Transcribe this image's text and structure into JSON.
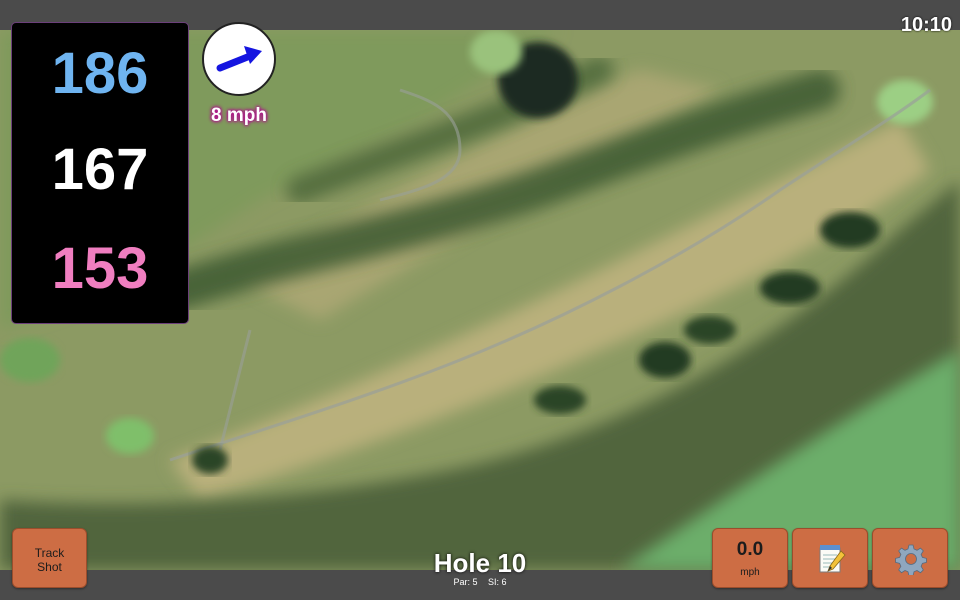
{
  "status": {
    "time": "10:10"
  },
  "distances": {
    "back": "186",
    "middle": "167",
    "front": "153"
  },
  "wind": {
    "speed_label": "8 mph"
  },
  "buttons": {
    "track_shot_line1": "Track",
    "track_shot_line2": "Shot",
    "speed_value": "0.0",
    "speed_unit": "mph"
  },
  "hole": {
    "title": "Hole 10",
    "par": "Par: 5",
    "stroke_index": "SI: 6"
  },
  "icons": {
    "wind": "wind-arrow-icon",
    "notes": "scorecard-notepad-icon",
    "settings": "gear-icon"
  },
  "colors": {
    "back": "#6fb4f0",
    "middle": "#ffffff",
    "front": "#f07ec0",
    "button": "#cd6d44",
    "wind_arrow": "#1515e0"
  }
}
